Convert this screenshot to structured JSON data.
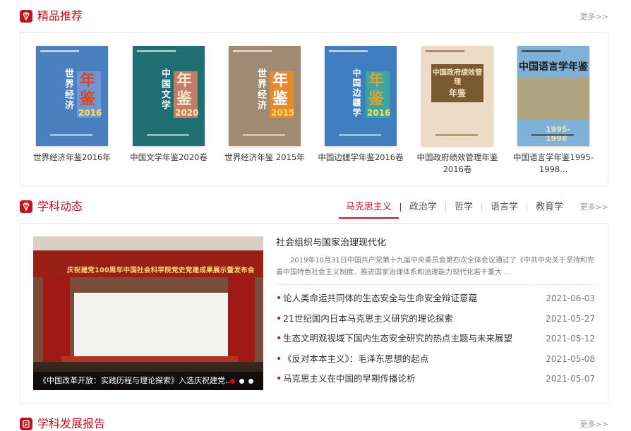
{
  "featured": {
    "title": "精品推荐",
    "more": "更多>>",
    "books": [
      {
        "title": "世界经济年鉴2016年",
        "cover": {
          "bg": "#4a7fc0",
          "text": "世界经济",
          "yearbook": "年鉴",
          "year": "2016",
          "accent": "#6b98d4",
          "text_color": "#ffffff",
          "yj_color": "#d7462a"
        }
      },
      {
        "title": "中国文学年鉴2020卷",
        "cover": {
          "bg": "#1f6e74",
          "text": "中国文学",
          "yearbook": "年鉴",
          "year": "2020",
          "accent": "#c07e6a",
          "text_color": "#ffffff",
          "yj_color": "#f3e3c8"
        }
      },
      {
        "title": "世界经济年鉴 2015年",
        "cover": {
          "bg": "#a18a72",
          "text": "世界经济",
          "yearbook": "年鉴",
          "year": "2015",
          "accent": "#e8892b",
          "text_color": "#ffffff",
          "yj_color": "#ffffff"
        }
      },
      {
        "title": "中国边疆学年鉴2016卷",
        "cover": {
          "bg": "#3f7fbf",
          "text": "中国边疆学",
          "yearbook": "年鉴",
          "year": "2016",
          "accent": "#39a6a4",
          "text_color": "#ffffff",
          "yj_color": "#d9a33a"
        }
      },
      {
        "title": "中国政府绩效管理年鉴2016卷",
        "cover": {
          "bg": "#ecdcc6",
          "text": "中国政府绩效管理",
          "yearbook": "年鉴",
          "year": "",
          "accent": "#7b5a2f",
          "text_color": "#7b5a2f",
          "yj_color": "#7b5a2f"
        }
      },
      {
        "title": "中国语言学年鉴1995-1998...",
        "cover": {
          "bg": "#7fb0d8",
          "text": "中国语言学年鉴",
          "yearbook": "",
          "year": "1995-1998",
          "accent": "#d89a3a",
          "text_color": "#1a1a1a",
          "yj_color": "#e8e0b8"
        }
      }
    ]
  },
  "dynamics": {
    "title": "学科动态",
    "more": "更多>>",
    "tabs": [
      "马克思主义",
      "政治学",
      "哲学",
      "语言学",
      "教育学"
    ],
    "active_tab": 0,
    "photo": {
      "banner": "庆祝建党100周年中国社会科学院党史党建成果展示暨发布会",
      "caption": "《中国改革开放：实践历程与理论探索》入选庆祝建党...",
      "slides": 3,
      "active_slide": 0
    },
    "lead": {
      "title": "社会组织与国家治理现代化",
      "summary": "2019年10月31日中国共产党第十九届中央委员会第四次全体会议通过了《中共中央关于坚持和完善中国特色社会主义制度、推进国家治理体系和治理能力现代化若干重大 ..."
    },
    "news": [
      {
        "title": "论人类命运共同体的生态安全与生命安全辩证意蕴",
        "date": "2021-06-03"
      },
      {
        "title": "21世纪国内日本马克思主义研究的理论探索",
        "date": "2021-05-27"
      },
      {
        "title": "生态文明观视域下国内生态安全研究的热点主题与未来展望",
        "date": "2021-05-12"
      },
      {
        "title": "《反对本本主义》：毛泽东思想的起点",
        "date": "2021-05-08"
      },
      {
        "title": "马克思主义在中国的早期传播论析",
        "date": "2021-05-07"
      }
    ]
  },
  "reports": {
    "title": "学科发展报告",
    "more": "更多>>"
  },
  "colors": {
    "accent": "#c1121f"
  }
}
